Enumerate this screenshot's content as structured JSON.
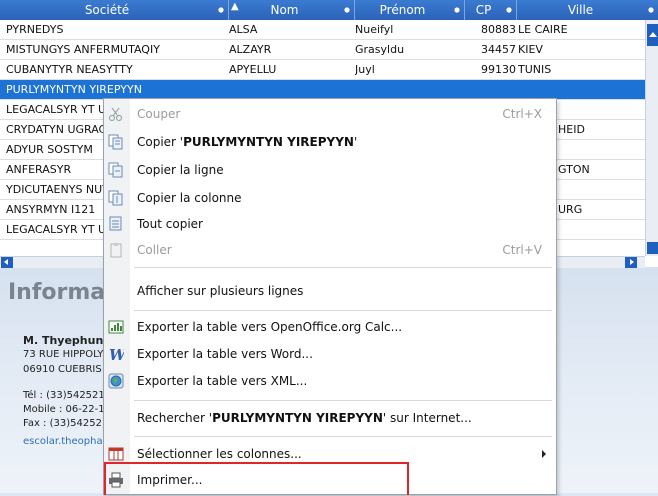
{
  "table": {
    "columns": [
      "Société",
      "Nom",
      "Prénom",
      "CP",
      "Ville"
    ],
    "rows": [
      {
        "societe": "PYRNEDYS",
        "nom": "ALSA",
        "prenom": "Nueifyl",
        "cp": "80883",
        "ville": "LE CAIRE"
      },
      {
        "societe": "MISTUNGYS ANFERMUTAQIY",
        "nom": "ALZAYR",
        "prenom": "Grasyldu",
        "cp": "34457",
        "ville": "KIEV"
      },
      {
        "societe": "CUBANYTYR NEASYTTY",
        "nom": "APYELLU",
        "prenom": "Juyl",
        "cp": "99130",
        "ville": "TUNIS"
      },
      {
        "societe": "PURLYMYNTYN YIREPYYN",
        "nom": "",
        "prenom": "",
        "cp": "",
        "ville": ""
      },
      {
        "societe": "LEGACALSYR YT U",
        "nom": "",
        "prenom": "",
        "cp": "",
        "ville": ""
      },
      {
        "societe": "CRYDATYN UGRACI",
        "nom": "",
        "prenom": "",
        "cp": "",
        "ville": "HEID"
      },
      {
        "societe": "ADYUR SOSTYM",
        "nom": "",
        "prenom": "",
        "cp": "",
        "ville": ""
      },
      {
        "societe": "ANFERASYR",
        "nom": "",
        "prenom": "",
        "cp": "",
        "ville": "GTON"
      },
      {
        "societe": "YDICUTAENYS NUT",
        "nom": "",
        "prenom": "",
        "cp": "",
        "ville": ""
      },
      {
        "societe": "ANSYRMYN I121",
        "nom": "",
        "prenom": "",
        "cp": "",
        "ville": "URG"
      },
      {
        "societe": "LEGACALSYR YT U",
        "nom": "",
        "prenom": "",
        "cp": "",
        "ville": ""
      }
    ]
  },
  "info": {
    "title": "Informat",
    "name": "M. Thyephuny",
    "address1": "73 RUE HIPPOLY",
    "address2": "06910 CUEBRIS",
    "tel": "Tél : (33)542521",
    "mobile": "Mobile : 06-22-1",
    "fax": "Fax : (33)54252",
    "email": "escolar.theopha"
  },
  "menu": {
    "cut": "Couper",
    "cut_shortcut": "Ctrl+X",
    "copy_prefix": "Copier '",
    "copy_value": "PURLYMYNTYN YIREPYYN",
    "copy_suffix": "'",
    "copy_line": "Copier la ligne",
    "copy_column": "Copier la colonne",
    "copy_all": "Tout copier",
    "paste": "Coller",
    "paste_shortcut": "Ctrl+V",
    "multiline": "Afficher sur plusieurs lignes",
    "export_calc": "Exporter la table vers OpenOffice.org Calc...",
    "export_word": "Exporter la table vers Word...",
    "export_xml": "Exporter la table vers XML...",
    "search_prefix": "Rechercher '",
    "search_value": "PURLYMYNTYN YIREPYYN",
    "search_suffix": "' sur Internet...",
    "select_columns": "Sélectionner les colonnes...",
    "print": "Imprimer..."
  },
  "colors": {
    "header": "#2b63b8",
    "selection": "#1d72d6",
    "highlight": "#e0262a"
  }
}
